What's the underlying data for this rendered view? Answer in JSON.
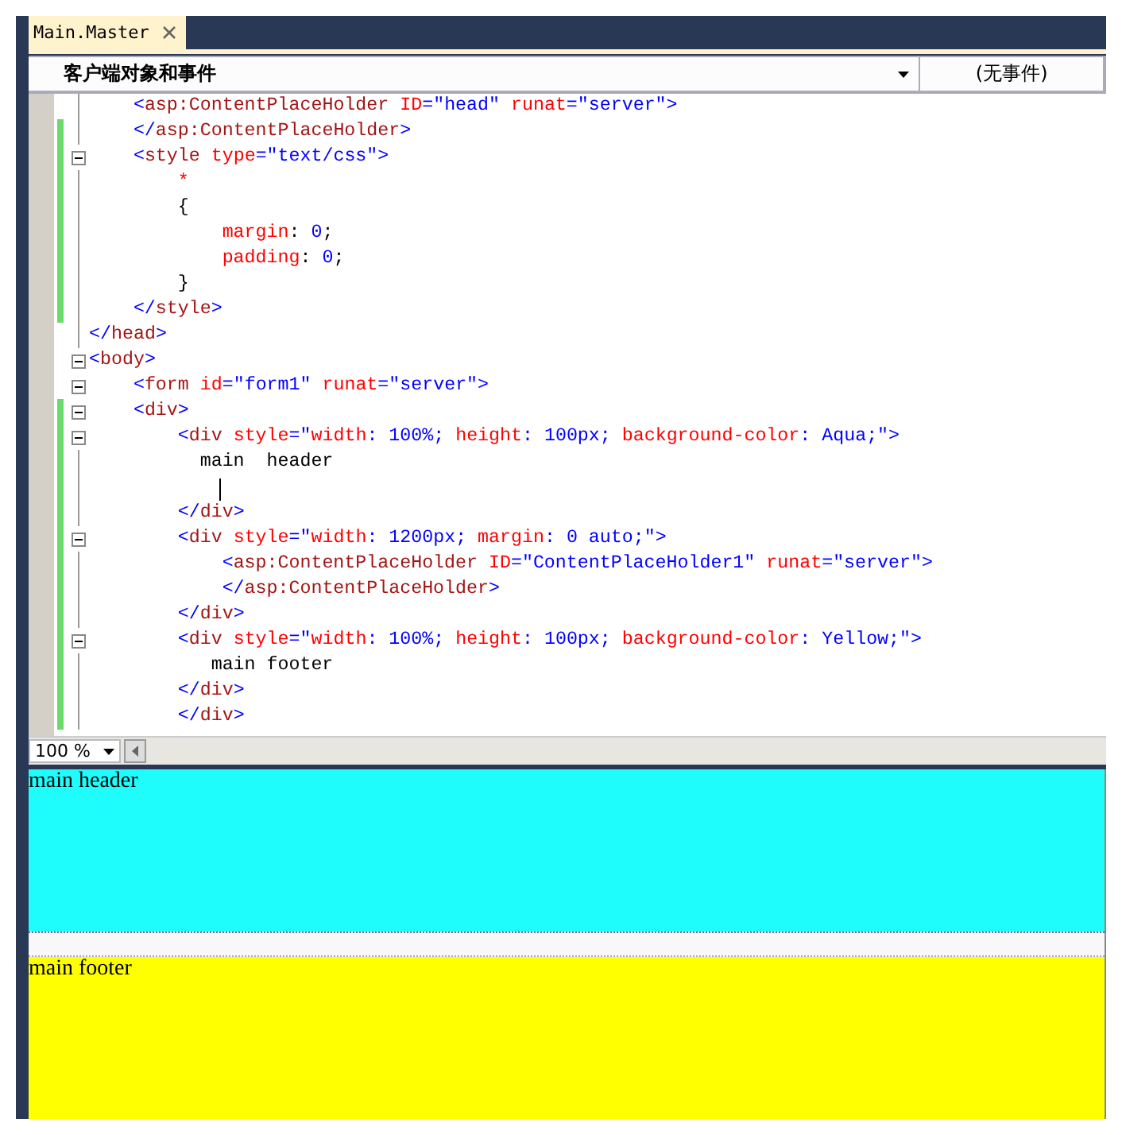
{
  "tab": {
    "label": "Main.Master",
    "selected": true
  },
  "object_dropdown": {
    "value": "客户端对象和事件"
  },
  "event_dropdown": {
    "value": "(无事件)"
  },
  "code_lines": [
    {
      "changed": false,
      "collapsible": false,
      "caret": false,
      "tokens": [
        {
          "kind": "delim",
          "text": "    <"
        },
        {
          "kind": "tag",
          "text": "asp:ContentPlaceHolder"
        },
        {
          "kind": "attr",
          "text": " ID"
        },
        {
          "kind": "delim",
          "text": "=\"head\""
        },
        {
          "kind": "attr",
          "text": " runat"
        },
        {
          "kind": "delim",
          "text": "=\"server\">"
        }
      ]
    },
    {
      "changed": true,
      "collapsible": false,
      "caret": false,
      "tokens": [
        {
          "kind": "delim",
          "text": "    </"
        },
        {
          "kind": "tag",
          "text": "asp:ContentPlaceHolder"
        },
        {
          "kind": "delim",
          "text": ">"
        }
      ]
    },
    {
      "changed": true,
      "collapsible": true,
      "caret": false,
      "tokens": [
        {
          "kind": "delim",
          "text": "    <"
        },
        {
          "kind": "tag",
          "text": "style"
        },
        {
          "kind": "attr",
          "text": " type"
        },
        {
          "kind": "delim",
          "text": "=\"text/css\">"
        }
      ]
    },
    {
      "changed": true,
      "collapsible": false,
      "caret": false,
      "tokens": [
        {
          "kind": "attr",
          "text": "        *"
        }
      ]
    },
    {
      "changed": true,
      "collapsible": false,
      "caret": false,
      "tokens": [
        {
          "kind": "text",
          "text": "        {"
        }
      ]
    },
    {
      "changed": true,
      "collapsible": false,
      "caret": false,
      "tokens": [
        {
          "kind": "attr",
          "text": "            margin"
        },
        {
          "kind": "text",
          "text": ": "
        },
        {
          "kind": "delim",
          "text": "0"
        },
        {
          "kind": "text",
          "text": ";"
        }
      ]
    },
    {
      "changed": true,
      "collapsible": false,
      "caret": false,
      "tokens": [
        {
          "kind": "attr",
          "text": "            padding"
        },
        {
          "kind": "text",
          "text": ": "
        },
        {
          "kind": "delim",
          "text": "0"
        },
        {
          "kind": "text",
          "text": ";"
        }
      ]
    },
    {
      "changed": true,
      "collapsible": false,
      "caret": false,
      "tokens": [
        {
          "kind": "text",
          "text": "        }"
        }
      ]
    },
    {
      "changed": true,
      "collapsible": false,
      "caret": false,
      "tokens": [
        {
          "kind": "delim",
          "text": "    </"
        },
        {
          "kind": "tag",
          "text": "style"
        },
        {
          "kind": "delim",
          "text": ">"
        }
      ]
    },
    {
      "changed": false,
      "collapsible": false,
      "caret": false,
      "tokens": [
        {
          "kind": "delim",
          "text": "</"
        },
        {
          "kind": "tag",
          "text": "head"
        },
        {
          "kind": "delim",
          "text": ">"
        }
      ]
    },
    {
      "changed": false,
      "collapsible": true,
      "caret": false,
      "tokens": [
        {
          "kind": "delim",
          "text": "<"
        },
        {
          "kind": "tag",
          "text": "body"
        },
        {
          "kind": "delim",
          "text": ">"
        }
      ]
    },
    {
      "changed": false,
      "collapsible": true,
      "caret": false,
      "tokens": [
        {
          "kind": "delim",
          "text": "    <"
        },
        {
          "kind": "tag",
          "text": "form"
        },
        {
          "kind": "attr",
          "text": " id"
        },
        {
          "kind": "delim",
          "text": "=\"form1\""
        },
        {
          "kind": "attr",
          "text": " runat"
        },
        {
          "kind": "delim",
          "text": "=\"server\">"
        }
      ]
    },
    {
      "changed": true,
      "collapsible": true,
      "caret": false,
      "tokens": [
        {
          "kind": "delim",
          "text": "    <"
        },
        {
          "kind": "tag",
          "text": "div"
        },
        {
          "kind": "delim",
          "text": ">"
        }
      ]
    },
    {
      "changed": true,
      "collapsible": true,
      "caret": false,
      "tokens": [
        {
          "kind": "delim",
          "text": "        <"
        },
        {
          "kind": "tag",
          "text": "div"
        },
        {
          "kind": "attr",
          "text": " style"
        },
        {
          "kind": "delim",
          "text": "=\""
        },
        {
          "kind": "attr",
          "text": "width"
        },
        {
          "kind": "delim",
          "text": ": 100%; "
        },
        {
          "kind": "attr",
          "text": "height"
        },
        {
          "kind": "delim",
          "text": ": 100px; "
        },
        {
          "kind": "attr",
          "text": "background-color"
        },
        {
          "kind": "delim",
          "text": ": Aqua;\">"
        }
      ]
    },
    {
      "changed": true,
      "collapsible": false,
      "caret": false,
      "tokens": [
        {
          "kind": "text",
          "text": "          main  header"
        }
      ]
    },
    {
      "changed": true,
      "collapsible": false,
      "caret": true
    },
    {
      "changed": true,
      "collapsible": false,
      "caret": false,
      "tokens": [
        {
          "kind": "delim",
          "text": "        </"
        },
        {
          "kind": "tag",
          "text": "div"
        },
        {
          "kind": "delim",
          "text": ">"
        }
      ]
    },
    {
      "changed": true,
      "collapsible": true,
      "caret": false,
      "tokens": [
        {
          "kind": "delim",
          "text": "        <"
        },
        {
          "kind": "tag",
          "text": "div"
        },
        {
          "kind": "attr",
          "text": " style"
        },
        {
          "kind": "delim",
          "text": "=\""
        },
        {
          "kind": "attr",
          "text": "width"
        },
        {
          "kind": "delim",
          "text": ": 1200px; "
        },
        {
          "kind": "attr",
          "text": "margin"
        },
        {
          "kind": "delim",
          "text": ": 0 auto;\">"
        }
      ]
    },
    {
      "changed": true,
      "collapsible": false,
      "caret": false,
      "tokens": [
        {
          "kind": "delim",
          "text": "            <"
        },
        {
          "kind": "tag",
          "text": "asp:ContentPlaceHolder"
        },
        {
          "kind": "attr",
          "text": " ID"
        },
        {
          "kind": "delim",
          "text": "=\"ContentPlaceHolder1\""
        },
        {
          "kind": "attr",
          "text": " runat"
        },
        {
          "kind": "delim",
          "text": "=\"server\">"
        }
      ]
    },
    {
      "changed": true,
      "collapsible": false,
      "caret": false,
      "tokens": [
        {
          "kind": "delim",
          "text": "            </"
        },
        {
          "kind": "tag",
          "text": "asp:ContentPlaceHolder"
        },
        {
          "kind": "delim",
          "text": ">"
        }
      ]
    },
    {
      "changed": true,
      "collapsible": false,
      "caret": false,
      "tokens": [
        {
          "kind": "delim",
          "text": "        </"
        },
        {
          "kind": "tag",
          "text": "div"
        },
        {
          "kind": "delim",
          "text": ">"
        }
      ]
    },
    {
      "changed": true,
      "collapsible": true,
      "caret": false,
      "tokens": [
        {
          "kind": "delim",
          "text": "        <"
        },
        {
          "kind": "tag",
          "text": "div"
        },
        {
          "kind": "attr",
          "text": " style"
        },
        {
          "kind": "delim",
          "text": "=\""
        },
        {
          "kind": "attr",
          "text": "width"
        },
        {
          "kind": "delim",
          "text": ": 100%; "
        },
        {
          "kind": "attr",
          "text": "height"
        },
        {
          "kind": "delim",
          "text": ": 100px; "
        },
        {
          "kind": "attr",
          "text": "background-color"
        },
        {
          "kind": "delim",
          "text": ": Yellow;\">"
        }
      ]
    },
    {
      "changed": true,
      "collapsible": false,
      "caret": false,
      "tokens": [
        {
          "kind": "text",
          "text": "           main footer"
        }
      ]
    },
    {
      "changed": true,
      "collapsible": false,
      "caret": false,
      "tokens": [
        {
          "kind": "delim",
          "text": "        </"
        },
        {
          "kind": "tag",
          "text": "div"
        },
        {
          "kind": "delim",
          "text": ">"
        }
      ]
    },
    {
      "changed": true,
      "collapsible": false,
      "caret": false,
      "tokens": [
        {
          "kind": "delim",
          "text": "        </"
        },
        {
          "kind": "tag",
          "text": "div"
        },
        {
          "kind": "delim",
          "text": ">"
        }
      ]
    }
  ],
  "zoom": {
    "value": "100 %"
  },
  "preview": {
    "header": "main header",
    "footer": "main footer"
  }
}
